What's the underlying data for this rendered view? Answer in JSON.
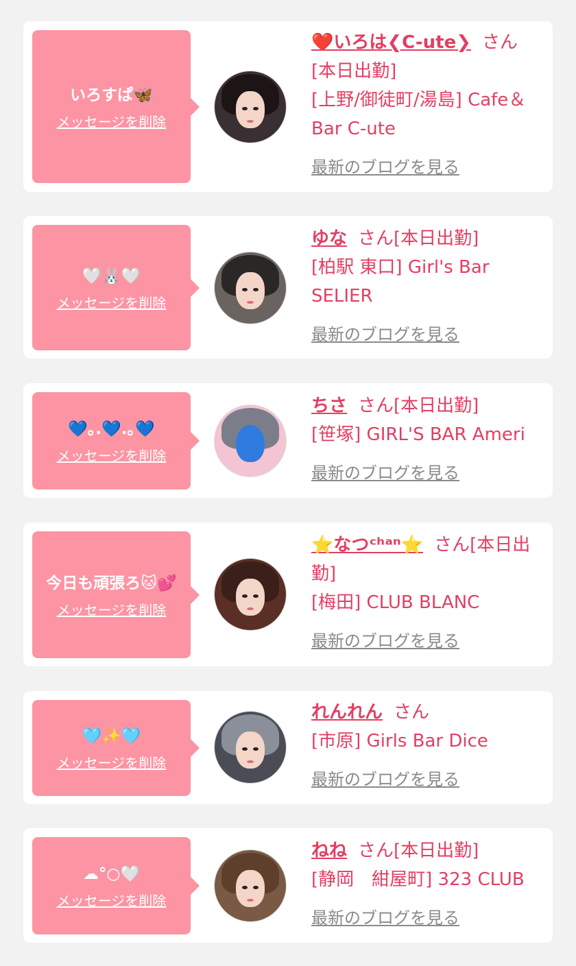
{
  "delete_label": "メッセージを削除",
  "blog_label": "最新のブログを見る",
  "colors": {
    "background": "#f2f2f2",
    "bubble": "#fc94a3",
    "accent": "#e33e62",
    "link_gray": "#8a8a8a"
  },
  "items": [
    {
      "message": "いろすぱ🦋",
      "name": "❤️いろは❮C-ute❯",
      "suffix": "さん",
      "lines": [
        "[本日出勤]",
        "[上野/御徒町/湯島] Cafe＆Bar C-ute"
      ]
    },
    {
      "message": "🤍🐰🤍",
      "name": "ゆな",
      "suffix": "さん[本日出勤]",
      "lines": [
        "[柏駅 東口] Girl's Bar SELIER"
      ]
    },
    {
      "message": "💙｡.💙.｡💙",
      "name": "ちさ",
      "suffix": "さん[本日出勤]",
      "lines": [
        "[笹塚] GIRL'S BAR Ameri"
      ]
    },
    {
      "message": "今日も頑張ろ🐱💕",
      "name": "⭐️なつᶜʰᵃⁿ⭐️",
      "suffix": "さん[本日出勤]",
      "lines": [
        "[梅田] CLUB BLANC"
      ]
    },
    {
      "message": "🩵✨🩵",
      "name": "れんれん",
      "suffix": "さん",
      "lines": [
        "[市原] Girls Bar Dice"
      ]
    },
    {
      "message": "☁︎°○🤍",
      "name": "ねね",
      "suffix": "さん[本日出勤]",
      "lines": [
        "[静岡　紺屋町] 323 CLUB"
      ]
    }
  ]
}
